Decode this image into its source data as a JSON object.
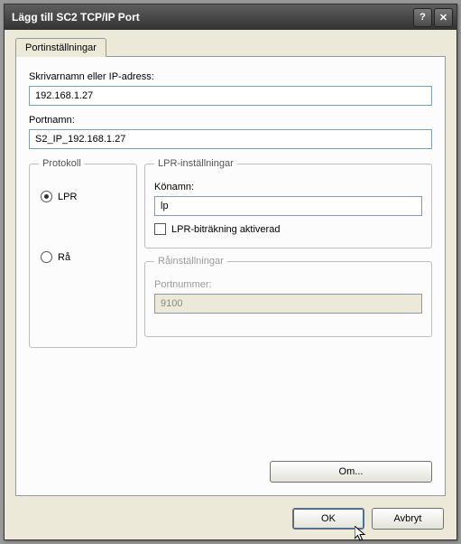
{
  "window": {
    "title": "Lägg till SC2 TCP/IP Port",
    "help_glyph": "?",
    "close_glyph": "✕"
  },
  "tab": {
    "label": "Portinställningar"
  },
  "printer": {
    "label": "Skrivarnamn eller IP-adress:",
    "value": "192.168.1.27"
  },
  "portname": {
    "label": "Portnamn:",
    "value": "S2_IP_192.168.1.27"
  },
  "protocol": {
    "legend": "Protokoll",
    "lpr_label": "LPR",
    "raw_label": "Rå",
    "selected": "lpr"
  },
  "lpr": {
    "legend": "LPR-inställningar",
    "queue_label": "Könamn:",
    "queue_value": "lp",
    "bytecount_label": "LPR-biträkning aktiverad",
    "bytecount_checked": false
  },
  "raw": {
    "legend": "Råinställningar",
    "port_label": "Portnummer:",
    "port_value": "9100",
    "enabled": false
  },
  "buttons": {
    "about": "Om...",
    "ok": "OK",
    "cancel": "Avbryt"
  }
}
